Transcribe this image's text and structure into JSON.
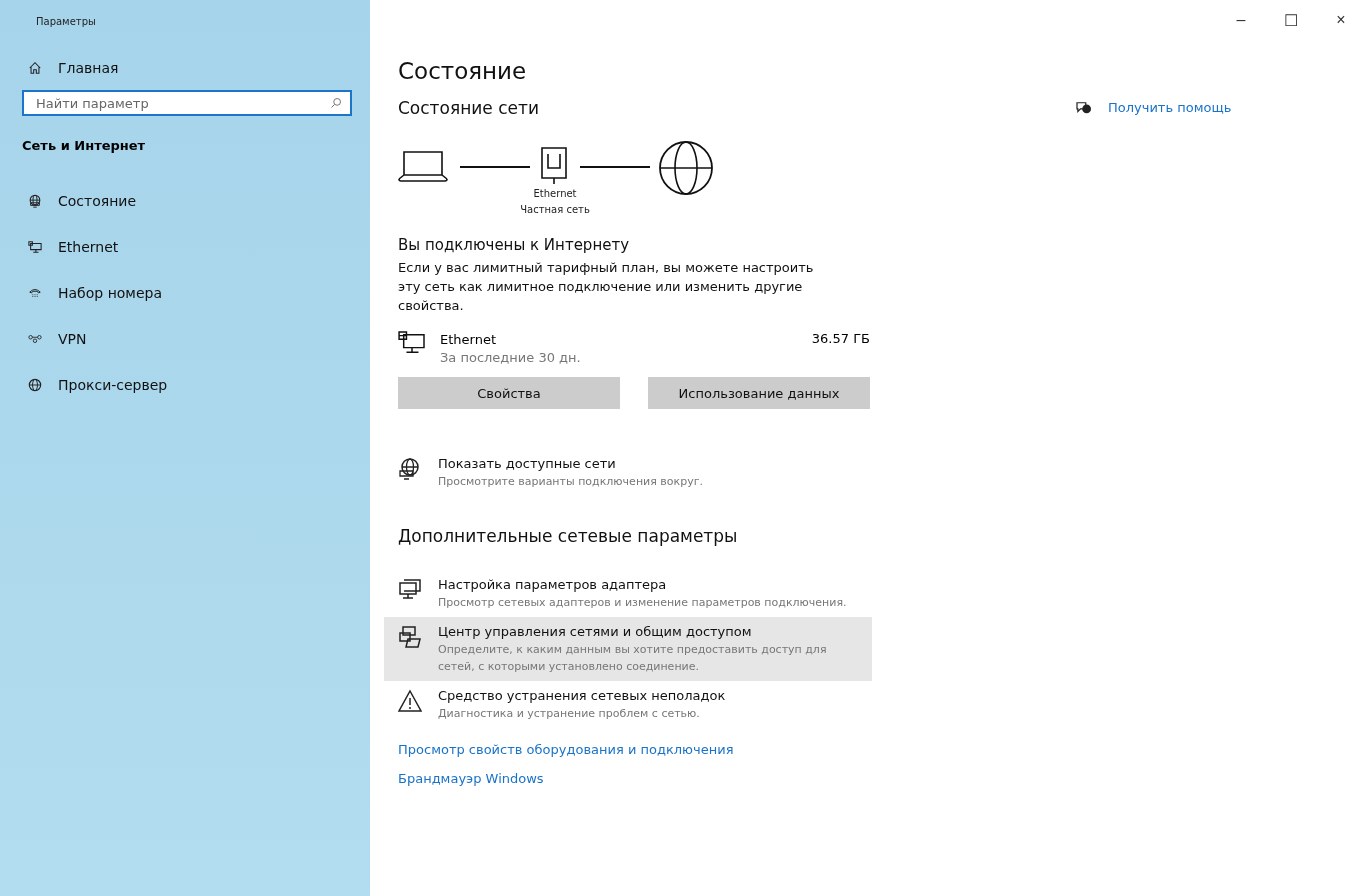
{
  "window": {
    "title": "Параметры",
    "controls": [
      "–",
      "☐",
      "×"
    ]
  },
  "sidebar": {
    "home": "Главная",
    "search": {
      "placeholder": "Найти параметр"
    },
    "section": "Сеть и Интернет",
    "items": [
      {
        "label": "Состояние"
      },
      {
        "label": "Ethernet"
      },
      {
        "label": "Набор номера"
      },
      {
        "label": "VPN"
      },
      {
        "label": "Прокси-сервер"
      }
    ]
  },
  "page": {
    "title": "Состояние",
    "subtitle": "Состояние сети",
    "diagram": {
      "adapter": "Ethernet",
      "network": "Частная сеть"
    },
    "status": "Вы подключены к Интернету",
    "description": "Если у вас лимитный тарифный план, вы можете настроить эту сеть как лимитное подключение или изменить другие свойства.",
    "connection": {
      "name": "Ethernet",
      "period": "За последние 30 дн.",
      "usage": "36.57 ГБ"
    },
    "buttons": [
      "Свойства",
      "Использование данных"
    ],
    "show_networks": {
      "title": "Показать доступные сети",
      "subtitle": "Просмотрите варианты подключения вокруг."
    },
    "advanced_heading": "Дополнительные сетевые параметры",
    "advanced": [
      {
        "title": "Настройка параметров адаптера",
        "subtitle": "Просмотр сетевых адаптеров и изменение параметров подключения.",
        "highlighted": false
      },
      {
        "title": "Центр управления сетями и общим доступом",
        "subtitle": "Определите, к каким данным вы хотите предоставить доступ для сетей, с которыми установлено соединение.",
        "highlighted": true
      },
      {
        "title": "Средство устранения сетевых неполадок",
        "subtitle": "Диагностика и устранение проблем с сетью.",
        "highlighted": false
      }
    ],
    "links": [
      "Просмотр свойств оборудования и подключения",
      "Брандмауэр Windows"
    ]
  },
  "help": {
    "label": "Получить помощь"
  }
}
